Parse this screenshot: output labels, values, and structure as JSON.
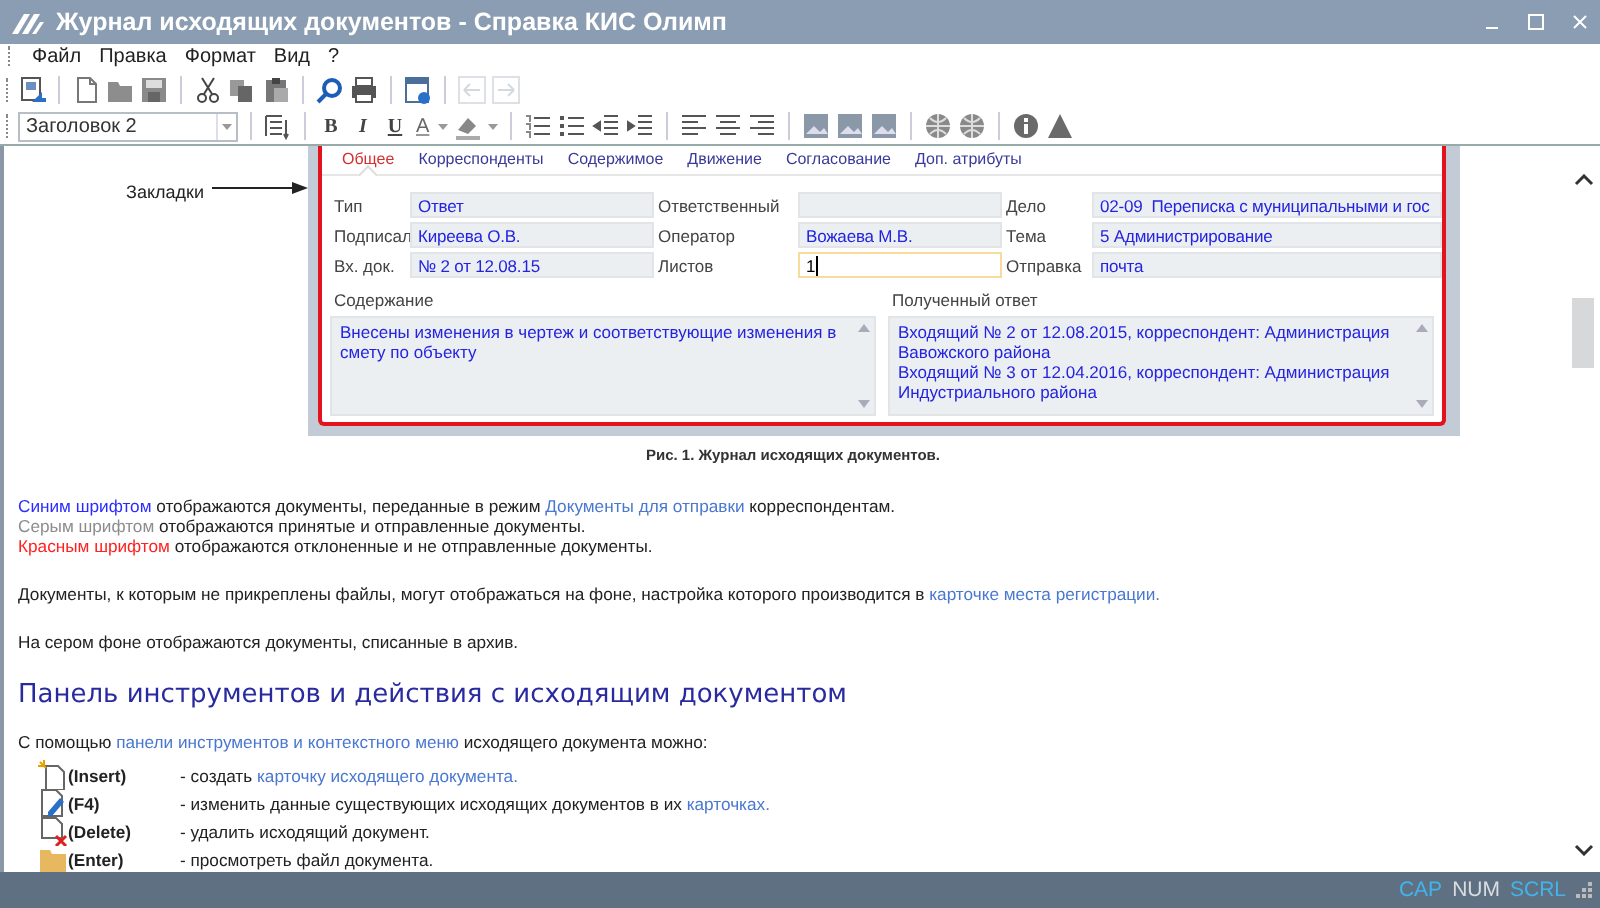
{
  "window": {
    "title": "Журнал исходящих документов - Справка КИС Олимп"
  },
  "menu": [
    "Файл",
    "Правка",
    "Формат",
    "Вид",
    "?"
  ],
  "toolbar": {
    "history_buttons": [
      {
        "disabled": true
      },
      {
        "disabled": true
      }
    ]
  },
  "format_bar": {
    "style_select": {
      "value": "Заголовок 2"
    },
    "text_buttons": [
      "B",
      "I",
      "U"
    ],
    "font_color_button": "A"
  },
  "figure": {
    "callout": "Закладки",
    "tabs": [
      {
        "label": "Общее",
        "selected": true
      },
      {
        "label": "Корреспонденты",
        "selected": false
      },
      {
        "label": "Содержимое",
        "selected": false
      },
      {
        "label": "Движение",
        "selected": false
      },
      {
        "label": "Согласование",
        "selected": false
      },
      {
        "label": "Доп. атрибуты",
        "selected": false
      }
    ],
    "fields": [
      {
        "label": "Тип",
        "value": "Ответ",
        "focused": false
      },
      {
        "label": "Ответственный",
        "focused": false
      },
      {
        "label": "Дело",
        "value": "02-09  Переписка с муниципальными и гос",
        "focused": false
      },
      {
        "label": "Подписал",
        "value": "Киреева О.В.",
        "focused": false
      },
      {
        "label": "Оператор",
        "value": "Вожаева М.В.",
        "focused": false
      },
      {
        "label": "Тема",
        "value": "5 Администрирование",
        "focused": false
      },
      {
        "label": "Вх. док.",
        "value": "№ 2 от 12.08.15",
        "focused": false
      },
      {
        "label": "Листов",
        "value": "1",
        "focused": true
      },
      {
        "label": "Отправка",
        "value": "почта",
        "focused": false
      }
    ],
    "memos": [
      {
        "label": "Содержание",
        "lines": [
          "Внесены изменения в чертеж и соответствующие изменения в смету по объекту"
        ]
      },
      {
        "label": "Полученный ответ",
        "lines": [
          "Входящий № 2 от 12.08.2015, корреспондент: Администрация Вавожского района",
          "Входящий № 3 от 12.04.2016, корреспондент: Администрация Индустриального района"
        ]
      }
    ]
  },
  "caption": "Рис. 1. Журнал исходящих документов.",
  "legend_lines": [
    [
      {
        "text": "Синим шрифтом",
        "kind": "legend",
        "color": "#2b2bff"
      },
      {
        "text": " отображаются документы, переданные в режим ",
        "kind": "text"
      },
      {
        "text": "Документы для отправки",
        "kind": "link"
      },
      {
        "text": " корреспондентам.",
        "kind": "text"
      }
    ],
    [
      {
        "text": "Серым шрифтом",
        "kind": "legend",
        "color": "#8c8c8c"
      },
      {
        "text": " отображаются принятые и отправленные документы.",
        "kind": "text"
      }
    ],
    [
      {
        "text": "Красным шрифтом",
        "kind": "legend",
        "color": "#ff2020"
      },
      {
        "text": " отображаются отклоненные и не отправленные документы.",
        "kind": "text"
      }
    ]
  ],
  "paragraphs": [
    [
      {
        "text": "Документы, к которым не прикреплены файлы, могут отображаться на фоне, настройка которого производится в ",
        "kind": "text"
      },
      {
        "text": "карточке места регистрации.",
        "kind": "link"
      }
    ],
    [
      {
        "text": "На сером фоне отображаются документы, списанные в архив.",
        "kind": "text"
      }
    ]
  ],
  "heading": "Панель инструментов и действия с исходящим документом",
  "intro": [
    {
      "text": "С помощью ",
      "kind": "text"
    },
    {
      "text": "панели инструментов и контекстного меню",
      "kind": "link"
    },
    {
      "text": " исходящего документа можно:",
      "kind": "text"
    }
  ],
  "actions": [
    {
      "kind": "create",
      "key": "(Insert)",
      "description": [
        {
          "text": "- создать ",
          "kind": "text"
        },
        {
          "text": "карточку исходящего документа.",
          "kind": "link"
        }
      ]
    },
    {
      "kind": "edit",
      "key": "(F4)",
      "description": [
        {
          "text": "- изменить данные существующих исходящих документов в их ",
          "kind": "text"
        },
        {
          "text": "карточках.",
          "kind": "link"
        }
      ]
    },
    {
      "kind": "delete",
      "key": "(Delete)",
      "description": [
        {
          "text": "- удалить исходящий документ.",
          "kind": "text"
        }
      ]
    },
    {
      "kind": "open",
      "key": "(Enter)",
      "description": [
        {
          "text": "- просмотреть файл документа.",
          "kind": "text"
        }
      ]
    }
  ],
  "status_bar": [
    {
      "label": "CAP",
      "on": true
    },
    {
      "label": "NUM",
      "on": false
    },
    {
      "label": "SCRL",
      "on": true
    }
  ]
}
